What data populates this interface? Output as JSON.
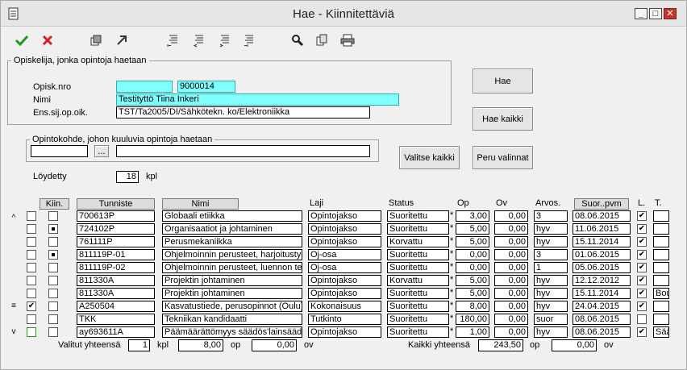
{
  "window": {
    "title": "Hae - Kiinnitettäviä"
  },
  "group_student": {
    "legend": "Opiskelija, jonka opintoja haetaan",
    "opisk_nro_label": "Opisk.nro",
    "opisk_nro_value": "9000014",
    "nimi_label": "Nimi",
    "nimi_value": "Testityttö Tiina Inkeri",
    "ens_label": "Ens.sij.op.oik.",
    "ens_value": "TST/Ta2005/DI/Sähkötekn. ko/Elektroniikka"
  },
  "group_target": {
    "legend": "Opintokohde, johon kuuluvia opintoja haetaan",
    "browse_label": "..."
  },
  "buttons": {
    "hae": "Hae",
    "hae_kaikki": "Hae kaikki",
    "valitse_kaikki": "Valitse kaikki",
    "peru_valinnat": "Peru valinnat"
  },
  "found": {
    "label": "Löydetty",
    "value": "18",
    "unit": "kpl"
  },
  "headers": {
    "kiin": "Kiin.",
    "tunniste": "Tunniste",
    "nimi": "Nimi",
    "laji": "Laji",
    "status": "Status",
    "op": "Op",
    "ov": "Ov",
    "arvos": "Arvos.",
    "suor_pvm": "Suor..pvm",
    "l": "L.",
    "t": "T."
  },
  "rows": [
    {
      "sel": false,
      "kiin": false,
      "tunniste": "700613P",
      "nimi": "Globaali etiikka",
      "laji": "Opintojakso",
      "status": "Suoritettu",
      "op": "3,00",
      "ov": "0,00",
      "arvos": "3",
      "pvm": "08.06.2015",
      "l": true,
      "t": ""
    },
    {
      "sel": false,
      "kiin": true,
      "tunniste": "724102P",
      "nimi": "Organisaatiot ja johtaminen",
      "laji": "Opintojakso",
      "status": "Suoritettu",
      "op": "5,00",
      "ov": "0,00",
      "arvos": "hyv",
      "pvm": "11.06.2015",
      "l": true,
      "t": ""
    },
    {
      "sel": false,
      "kiin": false,
      "tunniste": "761111P",
      "nimi": "Perusmekaniikka",
      "laji": "Opintojakso",
      "status": "Korvattu",
      "op": "5,00",
      "ov": "0,00",
      "arvos": "hyv",
      "pvm": "15.11.2014",
      "l": true,
      "t": ""
    },
    {
      "sel": false,
      "kiin": true,
      "tunniste": "811119P-01",
      "nimi": "Ohjelmoinnin perusteet, harjoitustyö",
      "laji": "Oj-osa",
      "status": "Suoritettu",
      "op": "0,00",
      "ov": "0,00",
      "arvos": "3",
      "pvm": "01.06.2015",
      "l": true,
      "t": ""
    },
    {
      "sel": false,
      "kiin": false,
      "tunniste": "811119P-02",
      "nimi": "Ohjelmoinnin perusteet, luennon tentti",
      "laji": "Oj-osa",
      "status": "Suoritettu",
      "op": "0,00",
      "ov": "0,00",
      "arvos": "1",
      "pvm": "05.06.2015",
      "l": true,
      "t": ""
    },
    {
      "sel": false,
      "kiin": false,
      "tunniste": "811330A",
      "nimi": "Projektin johtaminen",
      "laji": "Opintojakso",
      "status": "Korvattu",
      "op": "5,00",
      "ov": "0,00",
      "arvos": "hyv",
      "pvm": "12.12.2012",
      "l": true,
      "t": ""
    },
    {
      "sel": false,
      "kiin": false,
      "tunniste": "811330A",
      "nimi": "Projektin johtaminen",
      "laji": "Opintojakso",
      "status": "Suoritettu",
      "op": "5,00",
      "ov": "0,00",
      "arvos": "hyv",
      "pvm": "15.11.2014",
      "l": true,
      "t": "Bou"
    },
    {
      "sel": true,
      "kiin": false,
      "tunniste": "A250504",
      "nimi": "Kasvatustiede, perusopinnot (Oulu)",
      "laji": "Kokonaisuus",
      "status": "Suoritettu",
      "op": "8,00",
      "ov": "0,00",
      "arvos": "hyv",
      "pvm": "24.04.2015",
      "l": true,
      "t": ""
    },
    {
      "sel": false,
      "kiin": false,
      "tunniste": "TKK",
      "nimi": "Tekniikan kandidaatti",
      "laji": "Tutkinto",
      "status": "Suoritettu",
      "op": "180,00",
      "ov": "0,00",
      "arvos": "suor",
      "pvm": "08.06.2015",
      "l": false,
      "t": ""
    },
    {
      "sel": false,
      "kiin": false,
      "tunniste": "ay693611A",
      "nimi": "Päämäärättömyys säädös'lainsäädäntö",
      "laji": "Opintojakso",
      "status": "Suoritettu",
      "op": "1,00",
      "ov": "0,00",
      "arvos": "hyv",
      "pvm": "08.06.2015",
      "l": true,
      "t": "Sää"
    }
  ],
  "totals": {
    "valitut_label": "Valitut yhteensä",
    "valitut_count": "1",
    "kpl": "kpl",
    "valitut_op": "8,00",
    "op": "op",
    "valitut_ov": "0,00",
    "ov": "ov",
    "kaikki_label": "Kaikki yhteensä",
    "kaikki_op": "243,50",
    "kaikki_ov": "0,00"
  }
}
